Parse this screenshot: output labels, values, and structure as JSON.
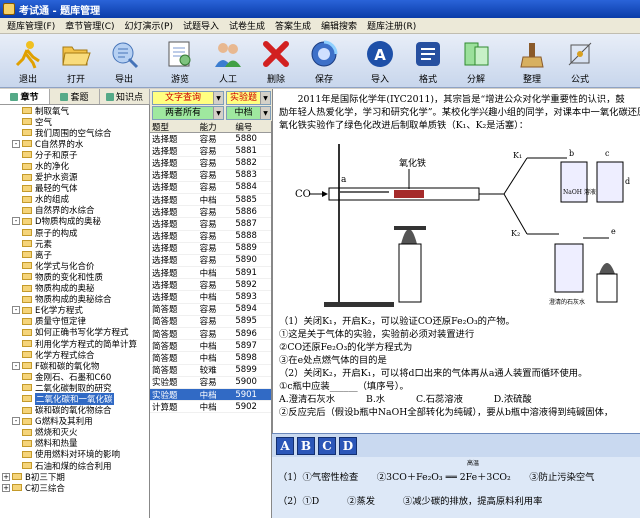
{
  "window": {
    "title": "考试通 - 题库管理"
  },
  "menu": [
    "题库管理(F)",
    "章节管理(C)",
    "幻灯演示(P)",
    "试题导入",
    "试卷生成",
    "答案生成",
    "编辑搜索",
    "题库注册(R)"
  ],
  "toolbar": [
    {
      "label": "退出",
      "icon": "exit-runner-icon"
    },
    {
      "label": "打开",
      "icon": "open-folder-icon"
    },
    {
      "label": "导出",
      "icon": "export-icon"
    },
    {
      "label": "游览",
      "icon": "browse-icon"
    },
    {
      "label": "人工",
      "icon": "users-icon"
    },
    {
      "label": "删除",
      "icon": "delete-x-icon"
    },
    {
      "label": "保存",
      "icon": "save-icon"
    },
    {
      "label": "导入",
      "icon": "import-icon"
    },
    {
      "label": "格式",
      "icon": "format-icon"
    },
    {
      "label": "分解",
      "icon": "split-icon"
    },
    {
      "label": "整理",
      "icon": "organize-icon"
    },
    {
      "label": "公式",
      "icon": "formula-icon"
    }
  ],
  "left_tabs": [
    "章节",
    "套题",
    "知识点"
  ],
  "tree": [
    {
      "label": "制取氧气",
      "level": 2
    },
    {
      "label": "空气",
      "level": 2
    },
    {
      "label": "我们周围的空气综合",
      "level": 2
    },
    {
      "label": "C自然界的水",
      "level": 1,
      "expander": "-"
    },
    {
      "label": "分子和原子",
      "level": 2
    },
    {
      "label": "水的净化",
      "level": 2
    },
    {
      "label": "爱护水资源",
      "level": 2
    },
    {
      "label": "最轻的气体",
      "level": 2
    },
    {
      "label": "水的组成",
      "level": 2
    },
    {
      "label": "自然界的水综合",
      "level": 2
    },
    {
      "label": "D物质构成的奥秘",
      "level": 1,
      "expander": "-"
    },
    {
      "label": "原子的构成",
      "level": 2
    },
    {
      "label": "元素",
      "level": 2
    },
    {
      "label": "离子",
      "level": 2
    },
    {
      "label": "化学式与化合价",
      "level": 2
    },
    {
      "label": "物质的变化和性质",
      "level": 2
    },
    {
      "label": "物质构成的奥秘",
      "level": 2
    },
    {
      "label": "物质构成的奥秘综合",
      "level": 2
    },
    {
      "label": "E化学方程式",
      "level": 1,
      "expander": "-"
    },
    {
      "label": "质量守恒定律",
      "level": 2
    },
    {
      "label": "如何正确书写化学方程式",
      "level": 2
    },
    {
      "label": "利用化学方程式的简单计算",
      "level": 2
    },
    {
      "label": "化学方程式综合",
      "level": 2
    },
    {
      "label": "F碳和碳的氧化物",
      "level": 1,
      "expander": "-"
    },
    {
      "label": "金刚石、石墨和C60",
      "level": 2
    },
    {
      "label": "二氧化碳制取的研究",
      "level": 2
    },
    {
      "label": "二氧化碳和一氧化碳",
      "level": 2,
      "selected": true
    },
    {
      "label": "碳和碳的氧化物综合",
      "level": 2
    },
    {
      "label": "G燃料及其利用",
      "level": 1,
      "expander": "-"
    },
    {
      "label": "燃烧和灭火",
      "level": 2
    },
    {
      "label": "燃料和热量",
      "level": 2
    },
    {
      "label": "使用燃料对环境的影响",
      "level": 2
    },
    {
      "label": "石油和煤的综合利用",
      "level": 2
    },
    {
      "label": "B初三下期",
      "level": 0,
      "expander": "+"
    },
    {
      "label": "C初三综合",
      "level": 0,
      "expander": "+"
    }
  ],
  "filters": {
    "type": "文字查询",
    "subtype": "实验题",
    "scope": "两者所有",
    "difficulty": "中档"
  },
  "table": {
    "headers": [
      "题型",
      "能力",
      "编号"
    ],
    "rows": [
      [
        "选择题",
        "容易",
        "5880"
      ],
      [
        "选择题",
        "容易",
        "5881"
      ],
      [
        "选择题",
        "容易",
        "5882"
      ],
      [
        "选择题",
        "容易",
        "5883"
      ],
      [
        "选择题",
        "容易",
        "5884"
      ],
      [
        "选择题",
        "中档",
        "5885"
      ],
      [
        "选择题",
        "容易",
        "5886"
      ],
      [
        "选择题",
        "容易",
        "5887"
      ],
      [
        "选择题",
        "容易",
        "5888"
      ],
      [
        "选择题",
        "容易",
        "5889"
      ],
      [
        "选择题",
        "容易",
        "5890"
      ],
      [
        "选择题",
        "中档",
        "5891"
      ],
      [
        "选择题",
        "容易",
        "5892"
      ],
      [
        "选择题",
        "中档",
        "5893"
      ],
      [
        "简答题",
        "容易",
        "5894"
      ],
      [
        "简答题",
        "容易",
        "5895"
      ],
      [
        "简答题",
        "容易",
        "5896"
      ],
      [
        "简答题",
        "中档",
        "5897"
      ],
      [
        "简答题",
        "中档",
        "5898"
      ],
      [
        "简答题",
        "较难",
        "5899"
      ],
      [
        "实验题",
        "容易",
        "5900"
      ],
      [
        "实验题",
        "中档",
        "5901"
      ],
      [
        "计算题",
        "中档",
        "5902"
      ]
    ],
    "selected_index": 21
  },
  "content": {
    "intro_1": "2011年是国际化学年(IYC2011)，其宗旨是“增进公众对化学重要性的认识，鼓",
    "intro_2": "励年轻人热爱化学，学习和研究化学”。某校化学兴趣小组的同学，对课本中一氧化碳还原",
    "intro_3": "氧化铁实验作了绿色化改进后制取单质铁（K₁、K₂是活塞）：",
    "diagram_labels": {
      "iron_oxide": "氧化铁",
      "co": "CO",
      "k1": "K₁",
      "k2": "K₂",
      "a": "a",
      "b": "b",
      "c": "c",
      "d": "d",
      "e": "e",
      "naoh": "NaOH 溶液",
      "limewater": "澄清的石灰水"
    },
    "q1": "（1）关闭K₁，开启K₂，可以验证CO还原Fe₂O₃的产物。",
    "q1_1": "①这是关于气体的实验，实验前必须对装置进行",
    "q1_2": "②CO还原Fe₂O₃的化学方程式为",
    "q1_3": "③在e处点燃气体的目的是",
    "q2": "（2）关闭K₂，开启K₁，可以将d口出来的气体再从a通人装置而循环使用。",
    "q2_1": "①c瓶中应装______（填序号）。",
    "q2_options": [
      "A.澄清石灰水",
      "B.水",
      "C.石蕊溶液",
      "D.浓硫酸"
    ],
    "q2_2": "②反应完后（假设b瓶中NaOH全部转化为纯碱），要从b瓶中溶液得到纯碱固体，"
  },
  "answer_buttons": [
    "A",
    "B",
    "C",
    "D"
  ],
  "answer": {
    "line1": "（1）①气密性检查　　②3CO＋Fe₂O₃ ══ 2Fe＋3CO₂　　③防止污染空气",
    "line1_cond": "高温",
    "line2": "（2）①D　　　②蒸发　　　③减少碳的排放，提高原料利用率"
  }
}
